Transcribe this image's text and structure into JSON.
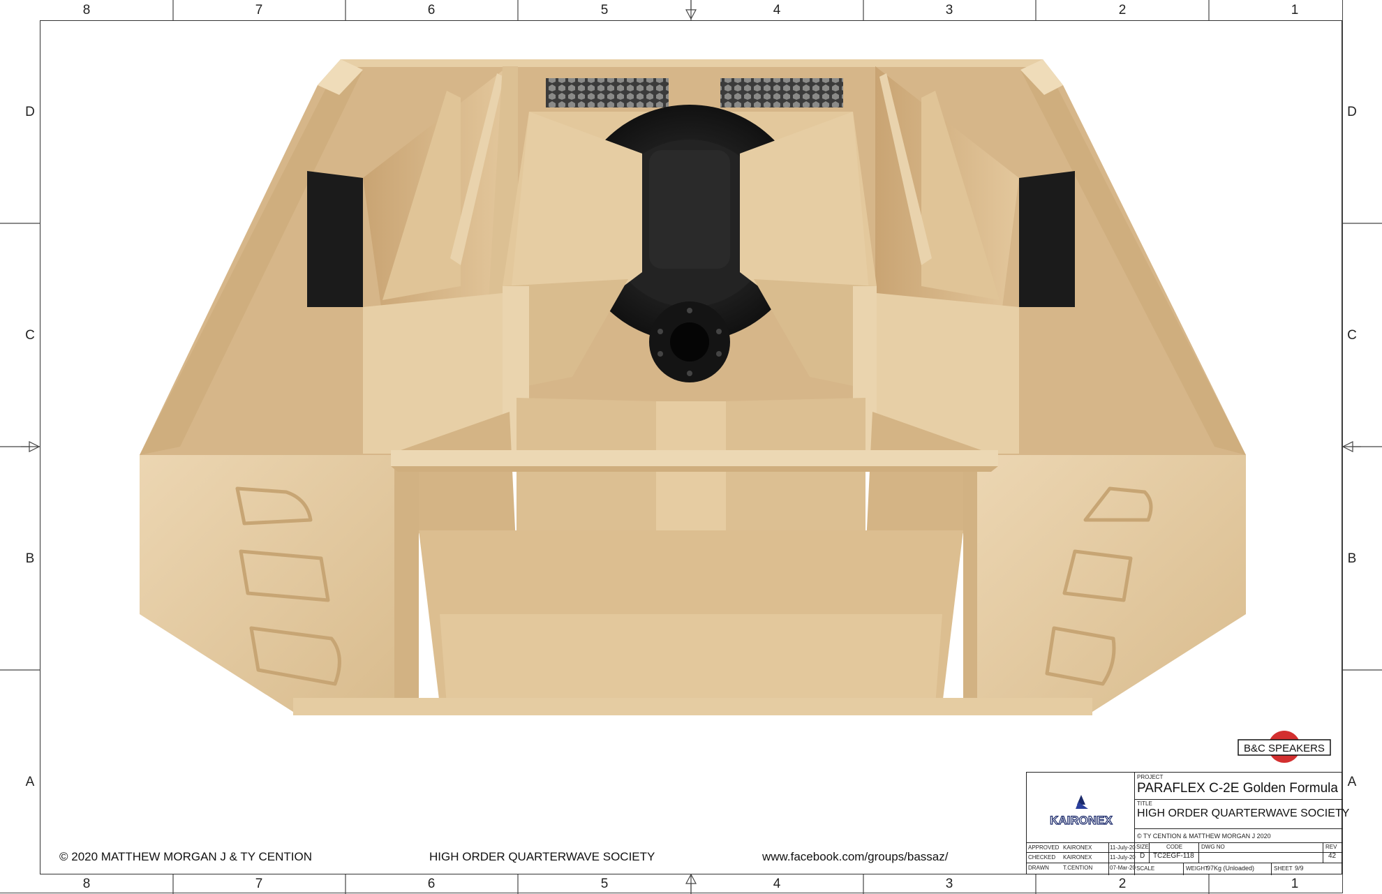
{
  "zones": {
    "columns_top": [
      "8",
      "7",
      "6",
      "5",
      "4",
      "3",
      "2",
      "1"
    ],
    "columns_bottom": [
      "8",
      "7",
      "6",
      "5",
      "4",
      "3",
      "2",
      "1"
    ],
    "rows_left": [
      "D",
      "C",
      "B",
      "A"
    ],
    "rows_right": [
      "D",
      "C",
      "B",
      "A"
    ]
  },
  "footer": {
    "copyright": "© 2020 MATTHEW MORGAN J & TY CENTION",
    "society": "HIGH ORDER QUARTERWAVE SOCIETY",
    "url": "www.facebook.com/groups/bassaz/"
  },
  "logos": {
    "bc_speakers": "B&C SPEAKERS",
    "kaironex": "KAIRONEX",
    "bc_color": "#d32f2f"
  },
  "title_block": {
    "project_label": "PROJECT",
    "project": "PARAFLEX C-2E Golden Formula",
    "title_label": "TITLE",
    "title": "HIGH ORDER QUARTERWAVE SOCIETY",
    "copyright": "© TY CENTION & MATTHEW MORGAN J 2020",
    "approved_label": "APPROVED",
    "approved_by": "KAIRONEX",
    "approved_date": "11-July-20",
    "checked_label": "CHECKED",
    "checked_by": "KAIRONEX",
    "checked_date": "11-July-20",
    "drawn_label": "DRAWN",
    "drawn_by": "T.CENTION",
    "drawn_date": "07-Mar-20",
    "size_label": "SIZE",
    "size": "D",
    "code_label": "CODE",
    "code": "TC2EGF-118",
    "dwg_label": "DWG NO",
    "dwg_no": "",
    "rev_label": "REV",
    "rev": "42",
    "scale_label": "SCALE",
    "weight_label": "WEIGHT",
    "weight": "97Kg (Unloaded)",
    "sheet_label": "SHEET",
    "sheet": "9/9"
  },
  "colors": {
    "wood_light": "#e9d2ad",
    "wood_mid": "#dcbf92",
    "wood_dark": "#c9a473",
    "driver": "#1c1c1c"
  }
}
